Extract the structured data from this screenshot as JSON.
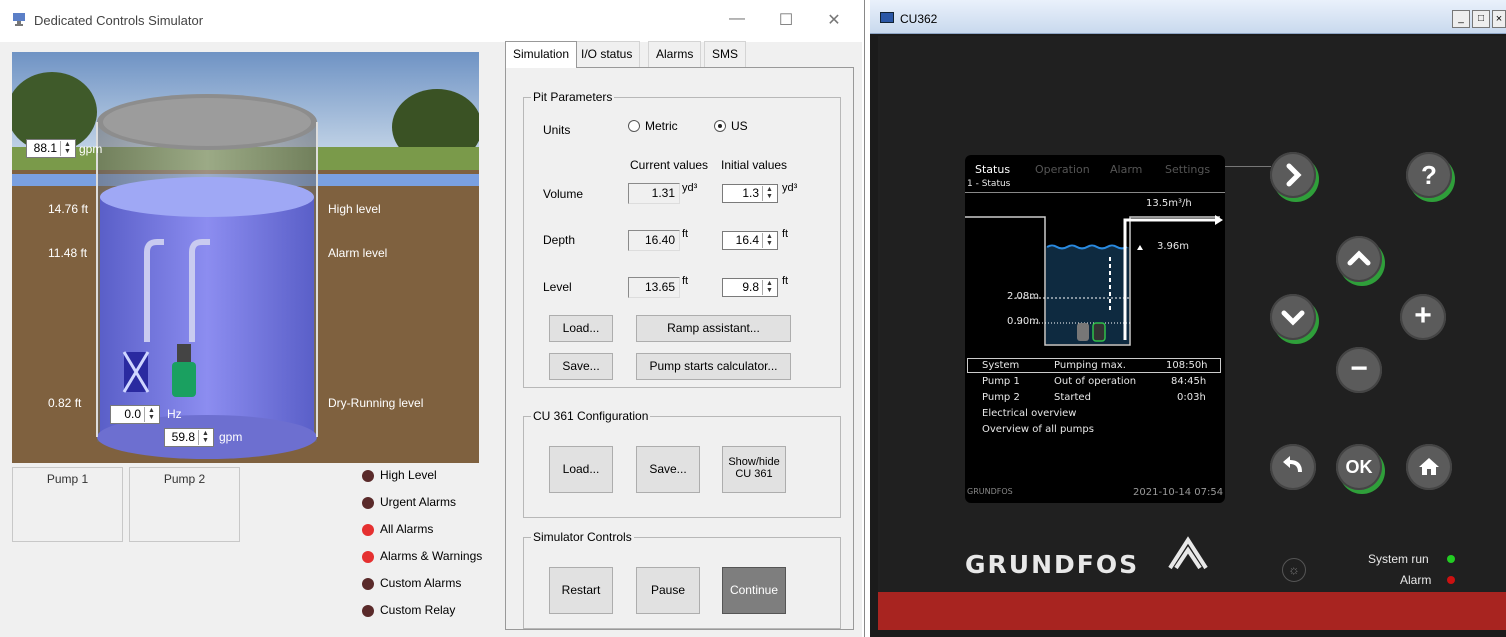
{
  "left": {
    "title": "Dedicated Controls Simulator",
    "window_buttons": [
      "—",
      "☐",
      "✕"
    ],
    "scene": {
      "levels": [
        {
          "value": "14.76 ft",
          "name": "High level"
        },
        {
          "value": "11.48 ft",
          "name": "Alarm level"
        },
        {
          "value": "0.82 ft",
          "name": "Dry-Running level"
        }
      ],
      "inflow": {
        "value": "88.1",
        "unit": "gpm"
      },
      "frequency": {
        "value": "0.0",
        "unit": "Hz"
      },
      "outflow": {
        "value": "59.8",
        "unit": "gpm"
      }
    },
    "pumps": [
      "Pump 1",
      "Pump 2"
    ],
    "indicators": [
      {
        "label": "High Level",
        "color": "#5a2a2a"
      },
      {
        "label": "Urgent Alarms",
        "color": "#5a2a2a"
      },
      {
        "label": "All Alarms",
        "color": "#e53030"
      },
      {
        "label": "Alarms & Warnings",
        "color": "#e53030"
      },
      {
        "label": "Custom Alarms",
        "color": "#5a2a2a"
      },
      {
        "label": "Custom Relay",
        "color": "#5a2a2a"
      }
    ],
    "tabs": [
      "Simulation",
      "I/O status",
      "Alarms",
      "SMS"
    ],
    "pit": {
      "title": "Pit Parameters",
      "units_label": "Units",
      "metric": "Metric",
      "us": "US",
      "current_header": "Current values",
      "initial_header": "Initial values",
      "rows": [
        {
          "label": "Volume",
          "current": "1.31",
          "initial": "1.3",
          "unit": "yd³"
        },
        {
          "label": "Depth",
          "current": "16.40",
          "initial": "16.4",
          "unit": "ft"
        },
        {
          "label": "Level",
          "current": "13.65",
          "initial": "9.8",
          "unit": "ft"
        }
      ],
      "load": "Load...",
      "save": "Save...",
      "ramp": "Ramp assistant...",
      "pump_starts": "Pump starts calculator..."
    },
    "cu361": {
      "title": "CU 361 Configuration",
      "load": "Load...",
      "save": "Save...",
      "show_hide_1": "Show/hide",
      "show_hide_2": "CU 361"
    },
    "controls": {
      "title": "Simulator Controls",
      "restart": "Restart",
      "pause": "Pause",
      "continue": "Continue"
    }
  },
  "right": {
    "title": "CU362",
    "screen": {
      "tabs": [
        "Status",
        "Operation",
        "Alarm",
        "Settings"
      ],
      "subtitle": "1 - Status",
      "flow": "13.5m³/h",
      "level": "3.96m",
      "mark1": "2.08m",
      "mark2": "0.90m",
      "rows": [
        {
          "c1": "System",
          "c2": "Pumping max.",
          "c3": "108:50h"
        },
        {
          "c1": "Pump 1",
          "c2": "Out of operation",
          "c3": "84:45h"
        },
        {
          "c1": "Pump 2",
          "c2": "Started",
          "c3": "0:03h"
        }
      ],
      "links": [
        "Electrical overview",
        "Overview of all pumps"
      ],
      "brand_small": "GRUNDFOS",
      "datetime": "2021-10-14 07:54"
    },
    "buttons": {
      "ok": "OK",
      "plus": "+",
      "minus": "−",
      "question": "?"
    },
    "brand": "GRUNDFOS",
    "status": {
      "system_run": "System run",
      "alarm": "Alarm",
      "run_color": "#22cc22",
      "alarm_color": "#cc1111"
    }
  }
}
